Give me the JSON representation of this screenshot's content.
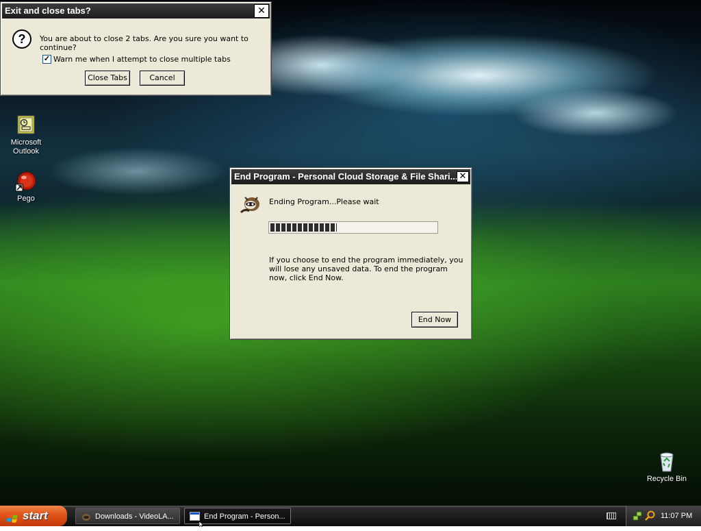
{
  "exit_dialog": {
    "title": "Exit and close tabs?",
    "message": "You are about to close 2 tabs. Are you sure you want to continue?",
    "checkbox_label": "Warn me when I attempt to close multiple tabs",
    "checkbox_checked": true,
    "close_tabs_label": "Close Tabs",
    "cancel_label": "Cancel",
    "close_glyph": "✕",
    "check_glyph": "✓",
    "question_glyph": "?"
  },
  "end_program_dialog": {
    "title": "End Program - Personal Cloud Storage & File Shari...",
    "status": "Ending Program...Please wait",
    "progress_fraction": 0.4,
    "message": "If you choose to end the program immediately, you will lose any unsaved data. To end the program now, click End Now.",
    "end_now_label": "End Now",
    "close_glyph": "✕"
  },
  "desktop": {
    "icons": [
      {
        "label": "Microsoft Outlook",
        "icon": "outlook-icon"
      },
      {
        "label": "Pego",
        "icon": "pego-icon"
      },
      {
        "label": "Recycle Bin",
        "icon": "recycle-bin-icon"
      }
    ]
  },
  "taskbar": {
    "start_label": "start",
    "tasks": [
      {
        "label": "Downloads - VideoLA...",
        "icon": "downloads-icon",
        "active": false
      },
      {
        "label": "End Program - Person...",
        "icon": "window-icon",
        "active": true
      }
    ],
    "clock": "11:07 PM"
  },
  "colors": {
    "title_bar": "#2b2b2b",
    "dialog_face": "#ece9d8",
    "progress_block": "#2b2b2b",
    "start_button": "#e0561b"
  }
}
